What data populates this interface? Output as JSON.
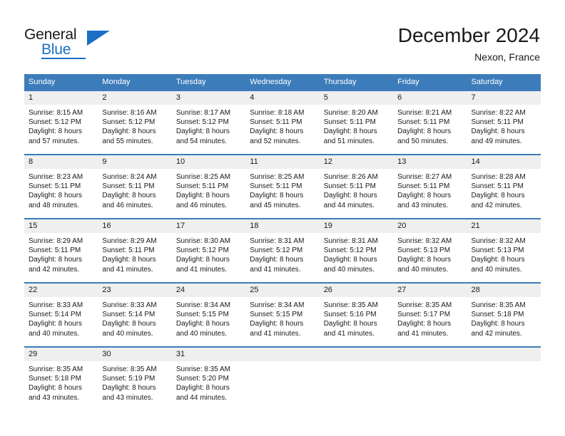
{
  "logo": {
    "primary_text": "General",
    "secondary_text": "Blue",
    "accent_color": "#1a6fc4"
  },
  "header": {
    "title": "December 2024",
    "subtitle": "Nexon, France"
  },
  "theme": {
    "header_row_bg": "#3d7cba",
    "daynum_bg": "#efefef",
    "text_color": "#1a1a1a"
  },
  "calendar": {
    "weekday_headers": [
      "Sunday",
      "Monday",
      "Tuesday",
      "Wednesday",
      "Thursday",
      "Friday",
      "Saturday"
    ],
    "weeks": [
      [
        {
          "day": "1",
          "sunrise": "Sunrise: 8:15 AM",
          "sunset": "Sunset: 5:12 PM",
          "daylight1": "Daylight: 8 hours",
          "daylight2": "and 57 minutes."
        },
        {
          "day": "2",
          "sunrise": "Sunrise: 8:16 AM",
          "sunset": "Sunset: 5:12 PM",
          "daylight1": "Daylight: 8 hours",
          "daylight2": "and 55 minutes."
        },
        {
          "day": "3",
          "sunrise": "Sunrise: 8:17 AM",
          "sunset": "Sunset: 5:12 PM",
          "daylight1": "Daylight: 8 hours",
          "daylight2": "and 54 minutes."
        },
        {
          "day": "4",
          "sunrise": "Sunrise: 8:18 AM",
          "sunset": "Sunset: 5:11 PM",
          "daylight1": "Daylight: 8 hours",
          "daylight2": "and 52 minutes."
        },
        {
          "day": "5",
          "sunrise": "Sunrise: 8:20 AM",
          "sunset": "Sunset: 5:11 PM",
          "daylight1": "Daylight: 8 hours",
          "daylight2": "and 51 minutes."
        },
        {
          "day": "6",
          "sunrise": "Sunrise: 8:21 AM",
          "sunset": "Sunset: 5:11 PM",
          "daylight1": "Daylight: 8 hours",
          "daylight2": "and 50 minutes."
        },
        {
          "day": "7",
          "sunrise": "Sunrise: 8:22 AM",
          "sunset": "Sunset: 5:11 PM",
          "daylight1": "Daylight: 8 hours",
          "daylight2": "and 49 minutes."
        }
      ],
      [
        {
          "day": "8",
          "sunrise": "Sunrise: 8:23 AM",
          "sunset": "Sunset: 5:11 PM",
          "daylight1": "Daylight: 8 hours",
          "daylight2": "and 48 minutes."
        },
        {
          "day": "9",
          "sunrise": "Sunrise: 8:24 AM",
          "sunset": "Sunset: 5:11 PM",
          "daylight1": "Daylight: 8 hours",
          "daylight2": "and 46 minutes."
        },
        {
          "day": "10",
          "sunrise": "Sunrise: 8:25 AM",
          "sunset": "Sunset: 5:11 PM",
          "daylight1": "Daylight: 8 hours",
          "daylight2": "and 46 minutes."
        },
        {
          "day": "11",
          "sunrise": "Sunrise: 8:25 AM",
          "sunset": "Sunset: 5:11 PM",
          "daylight1": "Daylight: 8 hours",
          "daylight2": "and 45 minutes."
        },
        {
          "day": "12",
          "sunrise": "Sunrise: 8:26 AM",
          "sunset": "Sunset: 5:11 PM",
          "daylight1": "Daylight: 8 hours",
          "daylight2": "and 44 minutes."
        },
        {
          "day": "13",
          "sunrise": "Sunrise: 8:27 AM",
          "sunset": "Sunset: 5:11 PM",
          "daylight1": "Daylight: 8 hours",
          "daylight2": "and 43 minutes."
        },
        {
          "day": "14",
          "sunrise": "Sunrise: 8:28 AM",
          "sunset": "Sunset: 5:11 PM",
          "daylight1": "Daylight: 8 hours",
          "daylight2": "and 42 minutes."
        }
      ],
      [
        {
          "day": "15",
          "sunrise": "Sunrise: 8:29 AM",
          "sunset": "Sunset: 5:11 PM",
          "daylight1": "Daylight: 8 hours",
          "daylight2": "and 42 minutes."
        },
        {
          "day": "16",
          "sunrise": "Sunrise: 8:29 AM",
          "sunset": "Sunset: 5:11 PM",
          "daylight1": "Daylight: 8 hours",
          "daylight2": "and 41 minutes."
        },
        {
          "day": "17",
          "sunrise": "Sunrise: 8:30 AM",
          "sunset": "Sunset: 5:12 PM",
          "daylight1": "Daylight: 8 hours",
          "daylight2": "and 41 minutes."
        },
        {
          "day": "18",
          "sunrise": "Sunrise: 8:31 AM",
          "sunset": "Sunset: 5:12 PM",
          "daylight1": "Daylight: 8 hours",
          "daylight2": "and 41 minutes."
        },
        {
          "day": "19",
          "sunrise": "Sunrise: 8:31 AM",
          "sunset": "Sunset: 5:12 PM",
          "daylight1": "Daylight: 8 hours",
          "daylight2": "and 40 minutes."
        },
        {
          "day": "20",
          "sunrise": "Sunrise: 8:32 AM",
          "sunset": "Sunset: 5:13 PM",
          "daylight1": "Daylight: 8 hours",
          "daylight2": "and 40 minutes."
        },
        {
          "day": "21",
          "sunrise": "Sunrise: 8:32 AM",
          "sunset": "Sunset: 5:13 PM",
          "daylight1": "Daylight: 8 hours",
          "daylight2": "and 40 minutes."
        }
      ],
      [
        {
          "day": "22",
          "sunrise": "Sunrise: 8:33 AM",
          "sunset": "Sunset: 5:14 PM",
          "daylight1": "Daylight: 8 hours",
          "daylight2": "and 40 minutes."
        },
        {
          "day": "23",
          "sunrise": "Sunrise: 8:33 AM",
          "sunset": "Sunset: 5:14 PM",
          "daylight1": "Daylight: 8 hours",
          "daylight2": "and 40 minutes."
        },
        {
          "day": "24",
          "sunrise": "Sunrise: 8:34 AM",
          "sunset": "Sunset: 5:15 PM",
          "daylight1": "Daylight: 8 hours",
          "daylight2": "and 40 minutes."
        },
        {
          "day": "25",
          "sunrise": "Sunrise: 8:34 AM",
          "sunset": "Sunset: 5:15 PM",
          "daylight1": "Daylight: 8 hours",
          "daylight2": "and 41 minutes."
        },
        {
          "day": "26",
          "sunrise": "Sunrise: 8:35 AM",
          "sunset": "Sunset: 5:16 PM",
          "daylight1": "Daylight: 8 hours",
          "daylight2": "and 41 minutes."
        },
        {
          "day": "27",
          "sunrise": "Sunrise: 8:35 AM",
          "sunset": "Sunset: 5:17 PM",
          "daylight1": "Daylight: 8 hours",
          "daylight2": "and 41 minutes."
        },
        {
          "day": "28",
          "sunrise": "Sunrise: 8:35 AM",
          "sunset": "Sunset: 5:18 PM",
          "daylight1": "Daylight: 8 hours",
          "daylight2": "and 42 minutes."
        }
      ],
      [
        {
          "day": "29",
          "sunrise": "Sunrise: 8:35 AM",
          "sunset": "Sunset: 5:18 PM",
          "daylight1": "Daylight: 8 hours",
          "daylight2": "and 43 minutes."
        },
        {
          "day": "30",
          "sunrise": "Sunrise: 8:35 AM",
          "sunset": "Sunset: 5:19 PM",
          "daylight1": "Daylight: 8 hours",
          "daylight2": "and 43 minutes."
        },
        {
          "day": "31",
          "sunrise": "Sunrise: 8:35 AM",
          "sunset": "Sunset: 5:20 PM",
          "daylight1": "Daylight: 8 hours",
          "daylight2": "and 44 minutes."
        },
        {
          "day": "",
          "sunrise": "",
          "sunset": "",
          "daylight1": "",
          "daylight2": ""
        },
        {
          "day": "",
          "sunrise": "",
          "sunset": "",
          "daylight1": "",
          "daylight2": ""
        },
        {
          "day": "",
          "sunrise": "",
          "sunset": "",
          "daylight1": "",
          "daylight2": ""
        },
        {
          "day": "",
          "sunrise": "",
          "sunset": "",
          "daylight1": "",
          "daylight2": ""
        }
      ]
    ]
  }
}
